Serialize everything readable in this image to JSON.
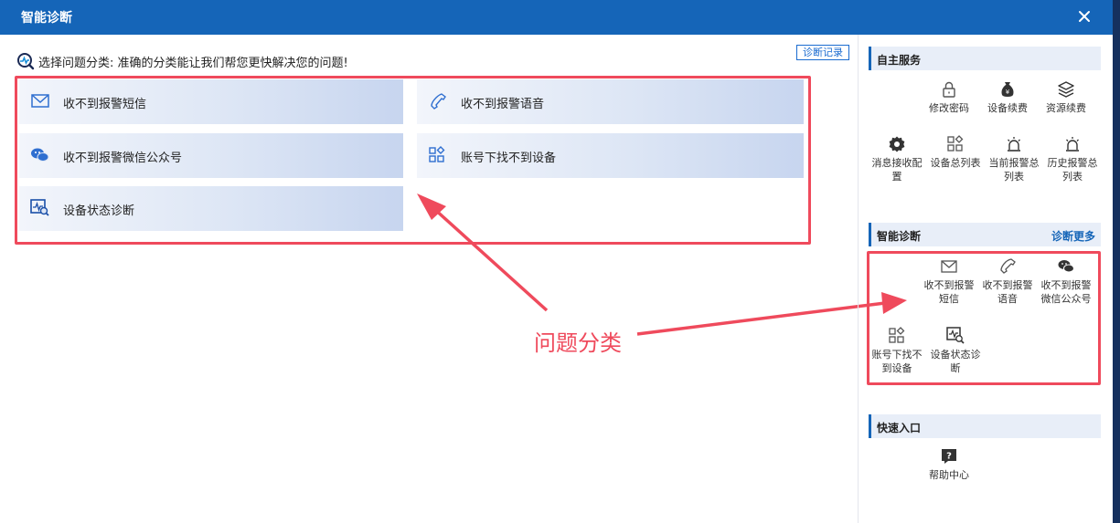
{
  "dialog": {
    "title": "智能诊断",
    "close_icon": "close-icon"
  },
  "main": {
    "header_text": "选择问题分类: 准确的分类能让我们帮您更快解决您的问题!",
    "diag_record_button": "诊断记录",
    "categories": [
      {
        "label": "收不到报警短信",
        "icon": "mail-icon"
      },
      {
        "label": "收不到报警语音",
        "icon": "phone-icon"
      },
      {
        "label": "收不到报警微信公众号",
        "icon": "wechat-icon"
      },
      {
        "label": "账号下找不到设备",
        "icon": "devices-grid-icon"
      },
      {
        "label": "设备状态诊断",
        "icon": "device-diagnose-icon"
      }
    ]
  },
  "annotation": {
    "label": "问题分类",
    "color": "#ef4a5c"
  },
  "sidebar": {
    "self_service": {
      "title": "自主服务",
      "items": [
        {
          "label": "修改密码",
          "icon": "lock-icon"
        },
        {
          "label": "设备续费",
          "icon": "money-bag-icon"
        },
        {
          "label": "资源续费",
          "icon": "layers-icon"
        },
        {
          "label": "消息接收配置",
          "icon": "gear-icon"
        },
        {
          "label": "设备总列表",
          "icon": "grid-icon"
        },
        {
          "label": "当前报警总列表",
          "icon": "alarm-icon"
        },
        {
          "label": "历史报警总列表",
          "icon": "alarm-history-icon"
        }
      ]
    },
    "smart_diag": {
      "title": "智能诊断",
      "more": "诊断更多",
      "items": [
        {
          "label": "收不到报警短信",
          "icon": "mail-icon"
        },
        {
          "label": "收不到报警语音",
          "icon": "phone-icon"
        },
        {
          "label": "收不到报警微信公众号",
          "icon": "wechat-icon"
        },
        {
          "label": "账号下找不到设备",
          "icon": "devices-grid-icon"
        },
        {
          "label": "设备状态诊断",
          "icon": "device-diagnose-icon"
        }
      ]
    },
    "quick_entry": {
      "title": "快速入口",
      "items": [
        {
          "label": "帮助中心",
          "icon": "help-icon"
        }
      ]
    }
  },
  "colors": {
    "title_bar": "#1565b8",
    "accent": "#1565b8",
    "annotation_red": "#ef4a5c"
  }
}
